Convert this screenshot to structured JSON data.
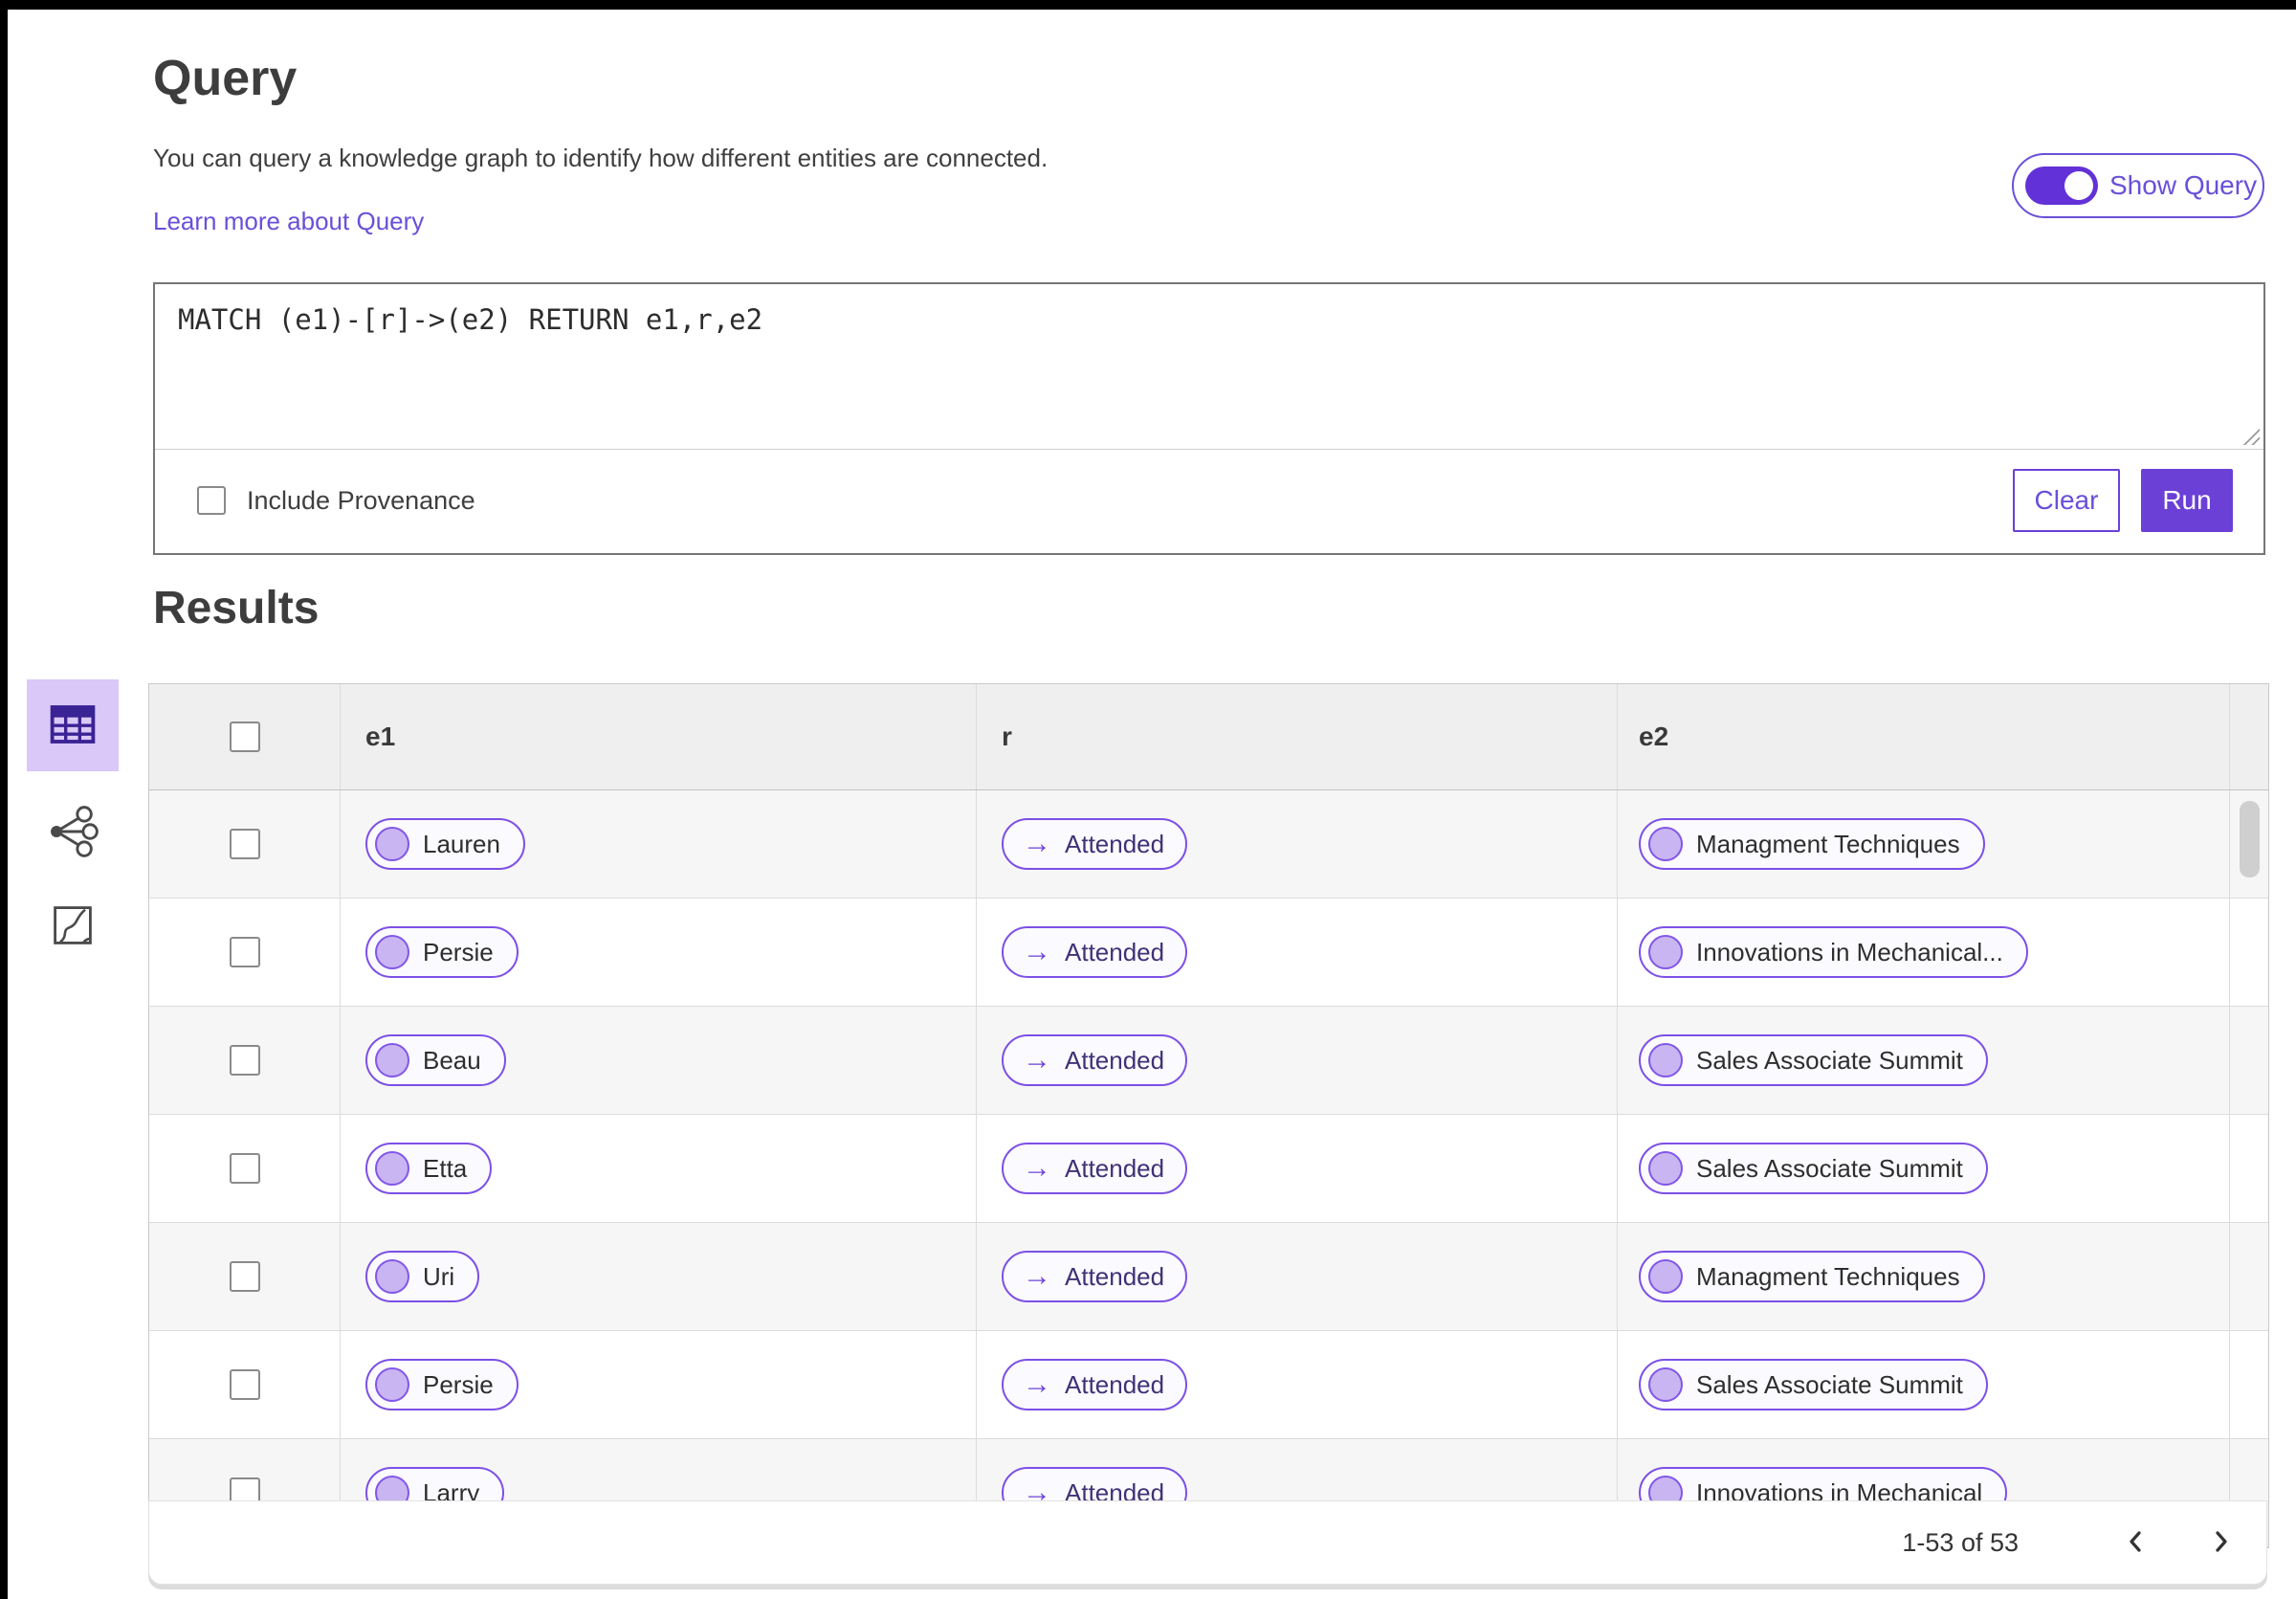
{
  "query_panel": {
    "title": "Query",
    "description": "You can query a knowledge graph to identify how different entities are connected.",
    "learn_more_link": "Learn more about Query",
    "show_query_toggle": {
      "label": "Show Query",
      "state": "on"
    },
    "editor": {
      "value": "MATCH (e1)-[r]->(e2) RETURN e1,r,e2"
    },
    "include_provenance": {
      "label": "Include Provenance",
      "checked": false
    },
    "buttons": {
      "clear": "Clear",
      "run": "Run"
    }
  },
  "results_panel": {
    "title": "Results",
    "view_switcher": [
      {
        "name": "table-view",
        "selected": true
      },
      {
        "name": "graph-view",
        "selected": false
      },
      {
        "name": "map-view",
        "selected": false
      }
    ],
    "table": {
      "columns": [
        "e1",
        "r",
        "e2"
      ],
      "relation_arrow": "→",
      "rows": [
        {
          "e1": "Lauren",
          "r": "Attended",
          "e2": "Managment Techniques"
        },
        {
          "e1": "Persie",
          "r": "Attended",
          "e2": "Innovations in Mechanical..."
        },
        {
          "e1": "Beau",
          "r": "Attended",
          "e2": "Sales Associate Summit"
        },
        {
          "e1": "Etta",
          "r": "Attended",
          "e2": "Sales Associate Summit"
        },
        {
          "e1": "Uri",
          "r": "Attended",
          "e2": "Managment Techniques"
        },
        {
          "e1": "Persie",
          "r": "Attended",
          "e2": "Sales Associate Summit"
        },
        {
          "e1": "Larry",
          "r": "Attended",
          "e2": "Innovations in Mechanical"
        }
      ]
    },
    "pagination": {
      "range_text": "1-53 of 53",
      "prev_icon": "chevron-left",
      "next_icon": "chevron-right"
    }
  },
  "colors": {
    "primary_purple": "#6b40d6",
    "toggle_purple": "#6231d8",
    "link_purple": "#6a4fd9",
    "pill_border": "#7c50e6",
    "pill_background": "#fbfaff",
    "entity_node_fill": "#c9b5f1",
    "relation_text": "#413176",
    "selected_tile_background": "#d9c8f8",
    "table_header_background": "#efefef",
    "row_stripe_background": "#f6f6f6"
  }
}
